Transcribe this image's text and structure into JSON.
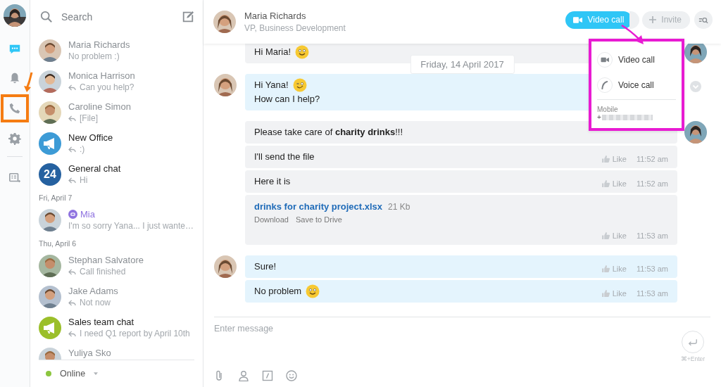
{
  "rail": {
    "items": [
      {
        "kind": "chat",
        "selected": true,
        "highlighted": false
      },
      {
        "kind": "bell",
        "selected": false,
        "highlighted": false
      },
      {
        "kind": "phone",
        "selected": false,
        "highlighted": true
      },
      {
        "kind": "gear",
        "selected": false,
        "highlighted": false
      },
      {
        "kind": "divider"
      },
      {
        "kind": "board",
        "selected": false,
        "highlighted": false
      }
    ]
  },
  "sidebar": {
    "search": {
      "placeholder": "Search"
    },
    "chats": [
      {
        "kind": "chat",
        "name": "Maria Richards",
        "preview": "No problem  :)",
        "reply": false,
        "unread": false,
        "bot": false
      },
      {
        "kind": "chat",
        "name": "Monica Harrison",
        "preview": "Can you help?",
        "reply": true,
        "unread": false,
        "bot": false
      },
      {
        "kind": "chat",
        "name": "Caroline Simon",
        "preview": "[File]",
        "reply": true,
        "unread": false,
        "bot": false
      },
      {
        "kind": "chat",
        "name": "New Office",
        "preview": ":)",
        "reply": true,
        "unread": true,
        "bot": false,
        "avatar": {
          "kind": "megaphone",
          "color": "#3d9bd6"
        }
      },
      {
        "kind": "chat",
        "name": "General chat",
        "preview": "Hi",
        "reply": true,
        "unread": true,
        "bot": false,
        "avatar": {
          "kind": "number",
          "text": "24",
          "color": "#2561a0"
        }
      },
      {
        "kind": "date",
        "label": "Fri, April 7"
      },
      {
        "kind": "chat",
        "name": "Mia",
        "preview": "I'm so sorry Yana... I just wante…",
        "reply": false,
        "unread": false,
        "bot": true
      },
      {
        "kind": "date",
        "label": "Thu, April 6"
      },
      {
        "kind": "chat",
        "name": "Stephan Salvatore",
        "preview": "Call finished",
        "reply": true,
        "unread": false,
        "bot": false
      },
      {
        "kind": "chat",
        "name": "Jake Adams",
        "preview": "Not now",
        "reply": true,
        "unread": false,
        "bot": false
      },
      {
        "kind": "chat",
        "name": "Sales team chat",
        "preview": "I need Q1 report by April 10th",
        "reply": true,
        "unread": true,
        "bot": false,
        "avatar": {
          "kind": "megaphone",
          "color": "#9bbf2a"
        }
      },
      {
        "kind": "chat",
        "name": "Yuliya Sko",
        "reply": false,
        "unread": false,
        "bot": false
      }
    ],
    "status": {
      "label": "Online",
      "online": true
    }
  },
  "header": {
    "name": "Maria Richards",
    "subtitle": "VP, Business Development",
    "video_button": "Video call",
    "invite_button": "Invite"
  },
  "call_menu": {
    "highlighted": true,
    "items": [
      {
        "kind": "video",
        "label": "Video call"
      },
      {
        "kind": "voice",
        "label": "Voice call"
      }
    ],
    "phone_label": "Mobile",
    "phone_prefix": "+"
  },
  "date_divider": "Friday, 14 April 2017",
  "messages": [
    {
      "kind": "outgoing",
      "hovered": false,
      "bubbles": [
        {
          "kind": "text",
          "lines": [
            "Hi Maria!"
          ],
          "emoji": {
            "kind": "smile"
          }
        }
      ]
    },
    {
      "kind": "incoming",
      "hovered": true,
      "bubbles": [
        {
          "kind": "text",
          "lines": [
            "Hi Yana!",
            "How can I help?"
          ],
          "emoji": {
            "kind": "wink"
          }
        }
      ]
    },
    {
      "kind": "outgoing",
      "hovered": false,
      "bubbles": [
        {
          "kind": "text",
          "lines": [
            "Please take care of **charity drinks**!!!"
          ]
        },
        {
          "kind": "text",
          "lines": [
            "I'll send the file"
          ],
          "like": "Like",
          "time": "11:52 am"
        },
        {
          "kind": "text",
          "lines": [
            "Here it is"
          ],
          "like": "Like",
          "time": "11:52 am"
        },
        {
          "kind": "file",
          "file_name": "drinks for charity project.xlsx",
          "size": "21 Kb",
          "actions": [
            "Download",
            "Save to Drive"
          ],
          "like": "Like",
          "time": "11:53 am"
        }
      ]
    },
    {
      "kind": "incoming",
      "hovered": false,
      "bubbles": [
        {
          "kind": "text",
          "lines": [
            "Sure!"
          ],
          "like": "Like",
          "time": "11:53 am"
        },
        {
          "kind": "text",
          "lines": [
            "No problem"
          ],
          "emoji": {
            "kind": "smile"
          },
          "like": "Like",
          "time": "11:53 am"
        }
      ]
    }
  ],
  "composer": {
    "placeholder": "Enter message",
    "send_hint": "⌘+Enter"
  }
}
